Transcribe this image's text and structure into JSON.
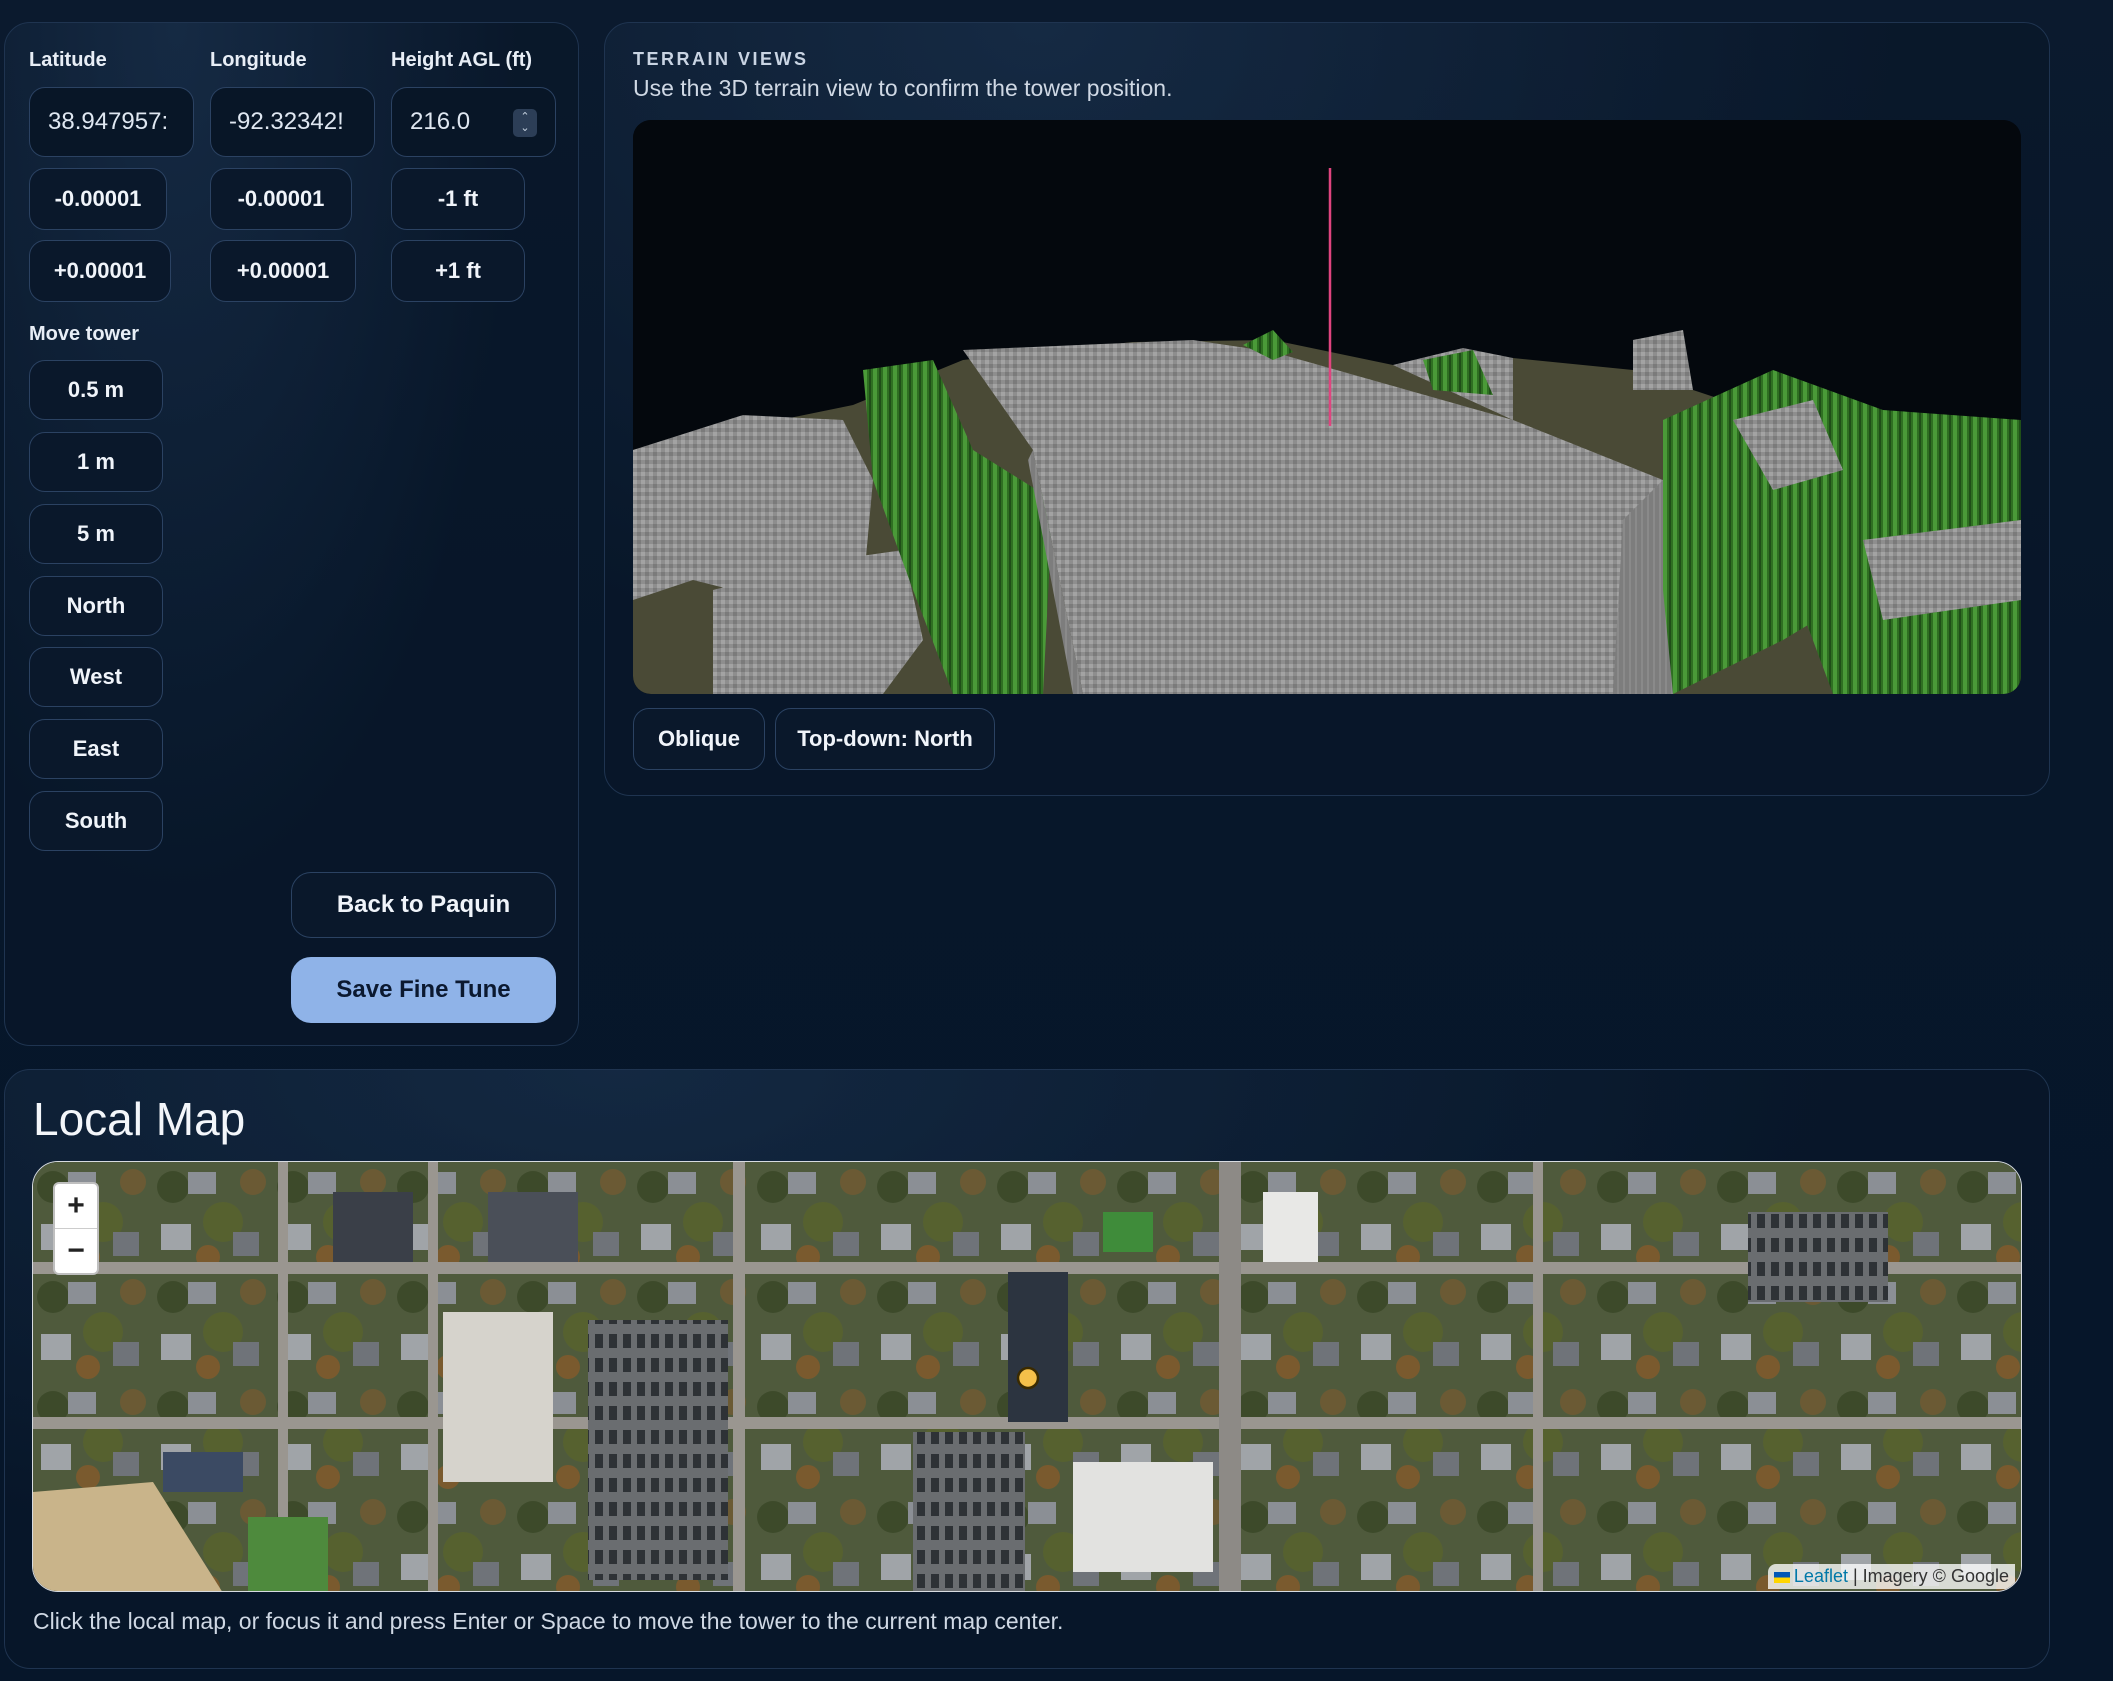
{
  "fields": {
    "latitude": {
      "label": "Latitude",
      "value": "38.947957:"
    },
    "longitude": {
      "label": "Longitude",
      "value": "-92.32342!"
    },
    "height": {
      "label": "Height AGL (ft)",
      "value": "216.0"
    }
  },
  "nudge": {
    "lat_minus": "-0.00001",
    "lat_plus": "+0.00001",
    "lon_minus": "-0.00001",
    "lon_plus": "+0.00001",
    "height_minus": "-1 ft",
    "height_plus": "+1 ft"
  },
  "move_tower": {
    "label": "Move tower",
    "steps": [
      "0.5 m",
      "1 m",
      "5 m"
    ],
    "directions": [
      "North",
      "West",
      "East",
      "South"
    ]
  },
  "actions": {
    "back": "Back to Paquin",
    "save": "Save Fine Tune"
  },
  "terrain": {
    "kicker": "TERRAIN VIEWS",
    "subtitle": "Use the 3D terrain view to confirm the tower position.",
    "views": [
      "Oblique",
      "Top-down: North"
    ]
  },
  "local_map": {
    "title": "Local Map",
    "zoom_in": "+",
    "zoom_out": "−",
    "attribution_link": "Leaflet",
    "attribution_text": "| Imagery © Google",
    "hint": "Click the local map, or focus it and press Enter or Space to move the tower to the current map center."
  },
  "colors": {
    "accent": "#8fb3e8",
    "tower_line": "#e0447f",
    "marker": "#f5c04a",
    "terrain_gray": "#9a9a9a",
    "terrain_green": "#3f8a2e"
  }
}
